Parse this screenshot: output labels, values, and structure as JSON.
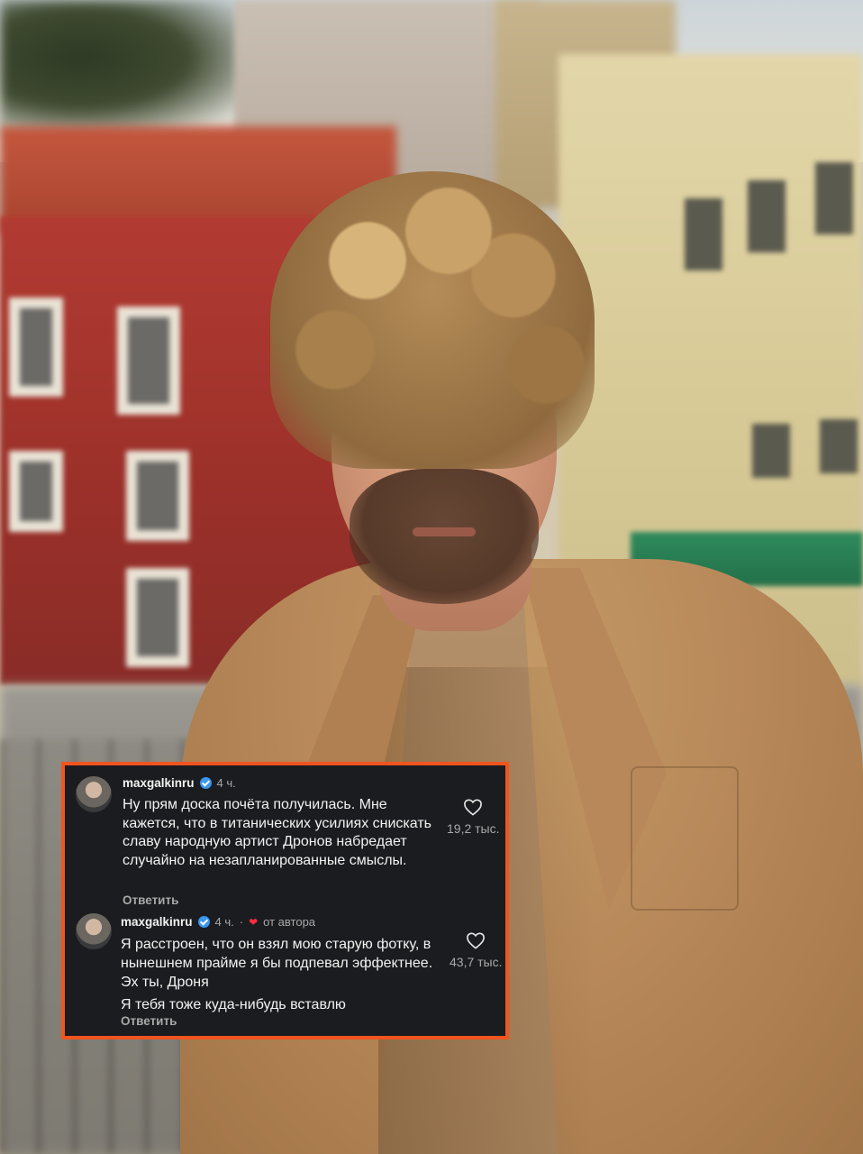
{
  "comments": [
    {
      "username": "maxgalkinru",
      "time": "4 ч.",
      "text": "Ну прям доска почёта получилась. Мне кажется, что в титанических усилиях снискать славу народную артист Дронов набредает случайно на незапланированные смыслы.",
      "reply_label": "Ответить",
      "likes": "19,2 тыс."
    },
    {
      "username": "maxgalkinru",
      "time": "4 ч.",
      "separator": "·",
      "author_badge": "от автора",
      "text": "Я расстроен, что он взял мою старую фотку, в нынешнем прайме я бы подпевал эффектнее. Эх ты, Дроня",
      "text_extra": "Я тебя тоже куда-нибудь вставлю",
      "reply_label": "Ответить",
      "likes": "43,7 тыс."
    }
  ],
  "icons": {
    "verified": "verified-badge-icon",
    "like": "heart-outline-icon",
    "author_like": "heart-filled-icon"
  },
  "colors": {
    "overlay_bg": "#1b1c20",
    "overlay_border": "#f0541f",
    "verified": "#3897f0",
    "author_heart": "#ff2d3d"
  }
}
